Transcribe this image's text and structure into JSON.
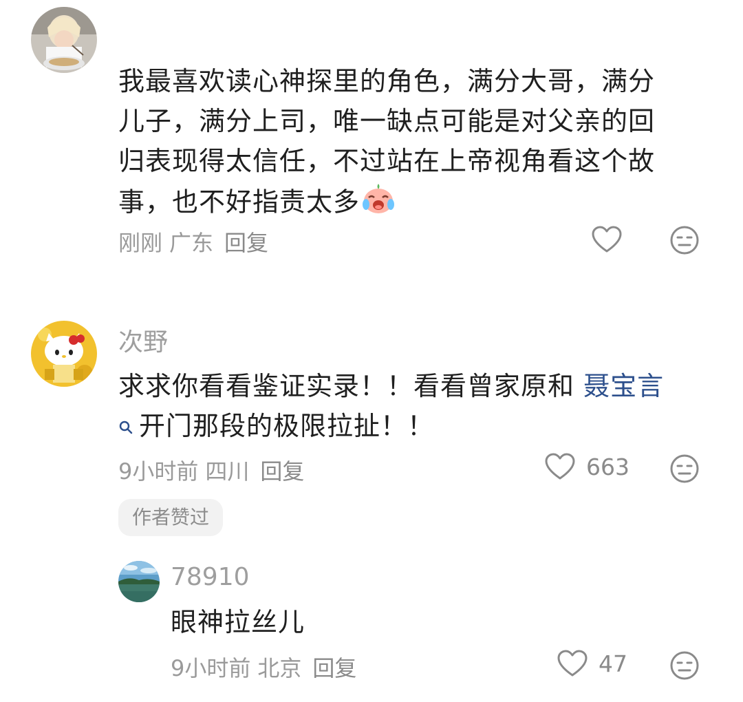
{
  "comments": [
    {
      "avatar_icon": "girl-eating-noodles-avatar",
      "username": "",
      "lines": [
        "我最喜欢读心神探里的角色，满分大哥，满分",
        "儿子，满分上司，唯一缺点可能是对父亲的回",
        "归表现得太信任，不过站在上帝视角看这个故",
        "事，也不好指责太多"
      ],
      "emoji": "crying-laugh-emoji",
      "time": "刚刚",
      "location": "广东",
      "reply_label": "回复",
      "like_count": "",
      "tag": ""
    },
    {
      "avatar_icon": "hello-kitty-avatar",
      "username": "次野",
      "line1_text": "求求你看看鉴证实录！！看看曾家原和",
      "line1_link": "聂宝言",
      "line2_text": "开门那段的极限拉扯！！",
      "time": "9小时前",
      "location": "四川",
      "reply_label": "回复",
      "like_count": "663",
      "tag": "作者赞过"
    },
    {
      "avatar_icon": "lake-landscape-avatar",
      "username": "78910",
      "text": "眼神拉丝儿",
      "time": "9小时前",
      "location": "北京",
      "reply_label": "回复",
      "like_count": "47",
      "tag": ""
    }
  ],
  "icons": {
    "like": "heart-outline-icon",
    "dislike": "neutral-face-icon",
    "search": "search-icon"
  },
  "colors": {
    "link": "#2c4f8c",
    "meta": "#9a9a9a",
    "tag_bg": "#f2f2f2"
  }
}
